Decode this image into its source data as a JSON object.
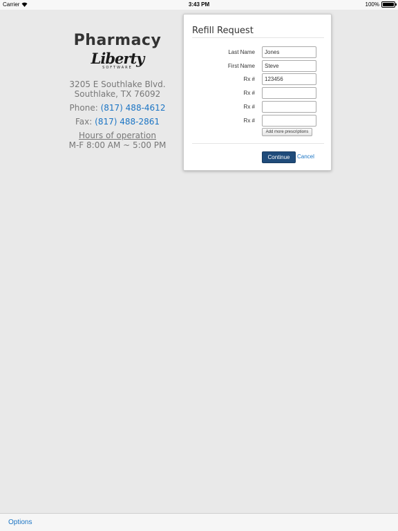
{
  "status_bar": {
    "carrier": "Carrier",
    "time": "3:43 PM",
    "battery": "100%",
    "battery_level": 1.0
  },
  "pharmacy": {
    "title": "Pharmacy",
    "logo_text": "Liberty",
    "logo_subtext": "SOFTWARE",
    "address_line1": "3205 E Southlake Blvd.",
    "address_line2": "Southlake, TX 76092",
    "phone_label": "Phone:",
    "phone": "(817) 488-4612",
    "fax_label": "Fax:",
    "fax": "(817) 488-2861",
    "hours_label": "Hours of operation",
    "hours": "M-F 8:00 AM ~ 5:00 PM"
  },
  "form": {
    "title": "Refill Request",
    "fields": [
      {
        "label": "Last Name",
        "value": "Jones"
      },
      {
        "label": "First Name",
        "value": "Steve"
      },
      {
        "label": "Rx #",
        "value": "123456"
      },
      {
        "label": "Rx #",
        "value": ""
      },
      {
        "label": "Rx #",
        "value": ""
      },
      {
        "label": "Rx #",
        "value": ""
      }
    ],
    "add_more_label": "Add more prescriptions",
    "continue_label": "Continue",
    "cancel_label": "Cancel"
  },
  "toolbar": {
    "options_label": "Options"
  },
  "colors": {
    "link": "#1a74c4",
    "primary_button": "#1f4b7a",
    "background": "#e9e9e9"
  }
}
